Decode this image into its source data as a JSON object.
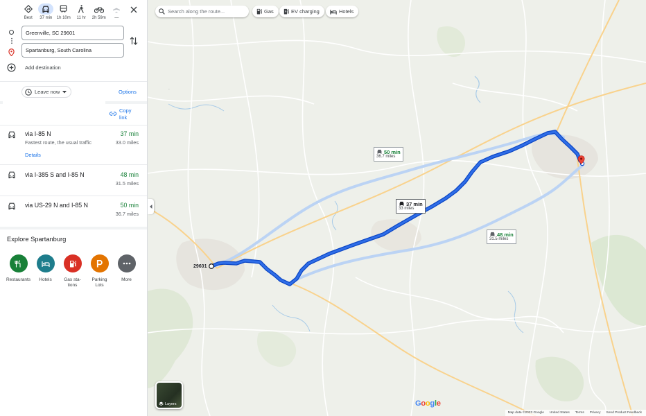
{
  "modes": [
    {
      "name": "best",
      "label": "Best",
      "icon": "diamond-directions-icon"
    },
    {
      "name": "driving",
      "label": "37 min",
      "icon": "car-icon"
    },
    {
      "name": "transit",
      "label": "1h 10m",
      "icon": "train-icon"
    },
    {
      "name": "walking",
      "label": "11 hr",
      "icon": "walk-icon"
    },
    {
      "name": "cycling",
      "label": "2h 59m",
      "icon": "bike-icon"
    },
    {
      "name": "flight",
      "label": "—",
      "icon": "plane-icon"
    }
  ],
  "waypoints": {
    "origin": "Greenville, SC 29601",
    "destination": "Spartanburg, South Carolina"
  },
  "add_destination": "Add destination",
  "leave_now": "Leave now",
  "options": "Options",
  "copy_link": [
    "Copy",
    "link"
  ],
  "routes": [
    {
      "via": "via I-85 N",
      "sub": "Fastest route, the usual traffic",
      "time": "37 min",
      "distance": "33.0 miles",
      "details": "Details"
    },
    {
      "via": "via I-385 S and I-85 N",
      "time": "48 min",
      "distance": "31.5 miles"
    },
    {
      "via": "via US-29 N and I-85 N",
      "time": "50 min",
      "distance": "36.7 miles"
    }
  ],
  "explore": {
    "title": "Explore Spartanburg",
    "categories": [
      {
        "label": "Restaurants",
        "color": "#188038",
        "icon": "restaurant-icon"
      },
      {
        "label": "Hotels",
        "color": "#1e7d8c",
        "icon": "hotel-icon"
      },
      {
        "label": "Gas sta-tions",
        "label_lines": [
          "Gas sta-",
          "tions"
        ],
        "color": "#d93025",
        "icon": "gas-station-icon"
      },
      {
        "label": "Parking Lots",
        "label_lines": [
          "Parking",
          "Lots"
        ],
        "color": "#e37400",
        "icon": "parking-icon"
      },
      {
        "label": "More",
        "color": "#5f6368",
        "icon": "more-icon"
      }
    ]
  },
  "map": {
    "search_placeholder": "Search along the route...",
    "chips": [
      {
        "label": "Gas",
        "icon": "gas-station-icon"
      },
      {
        "label": "EV charging",
        "icon": "ev-charging-icon"
      },
      {
        "label": "Hotels",
        "icon": "hotel-icon"
      }
    ],
    "route_labels": [
      {
        "time": "50 min",
        "dist": "36.7 miles"
      },
      {
        "time": "37 min",
        "dist": "33 miles"
      },
      {
        "time": "48 min",
        "dist": "31.5 miles"
      }
    ],
    "zip": "29601",
    "layers": "Layers",
    "google": "Google",
    "footer": [
      "Map data ©2023 Google",
      "United States",
      "Terms",
      "Privacy",
      "Send Product Feedback"
    ],
    "colors": {
      "route": "#1a73e8",
      "alt_route": "#bbd3f4",
      "road": "#ffffff",
      "highway": "#f9d28c"
    }
  }
}
